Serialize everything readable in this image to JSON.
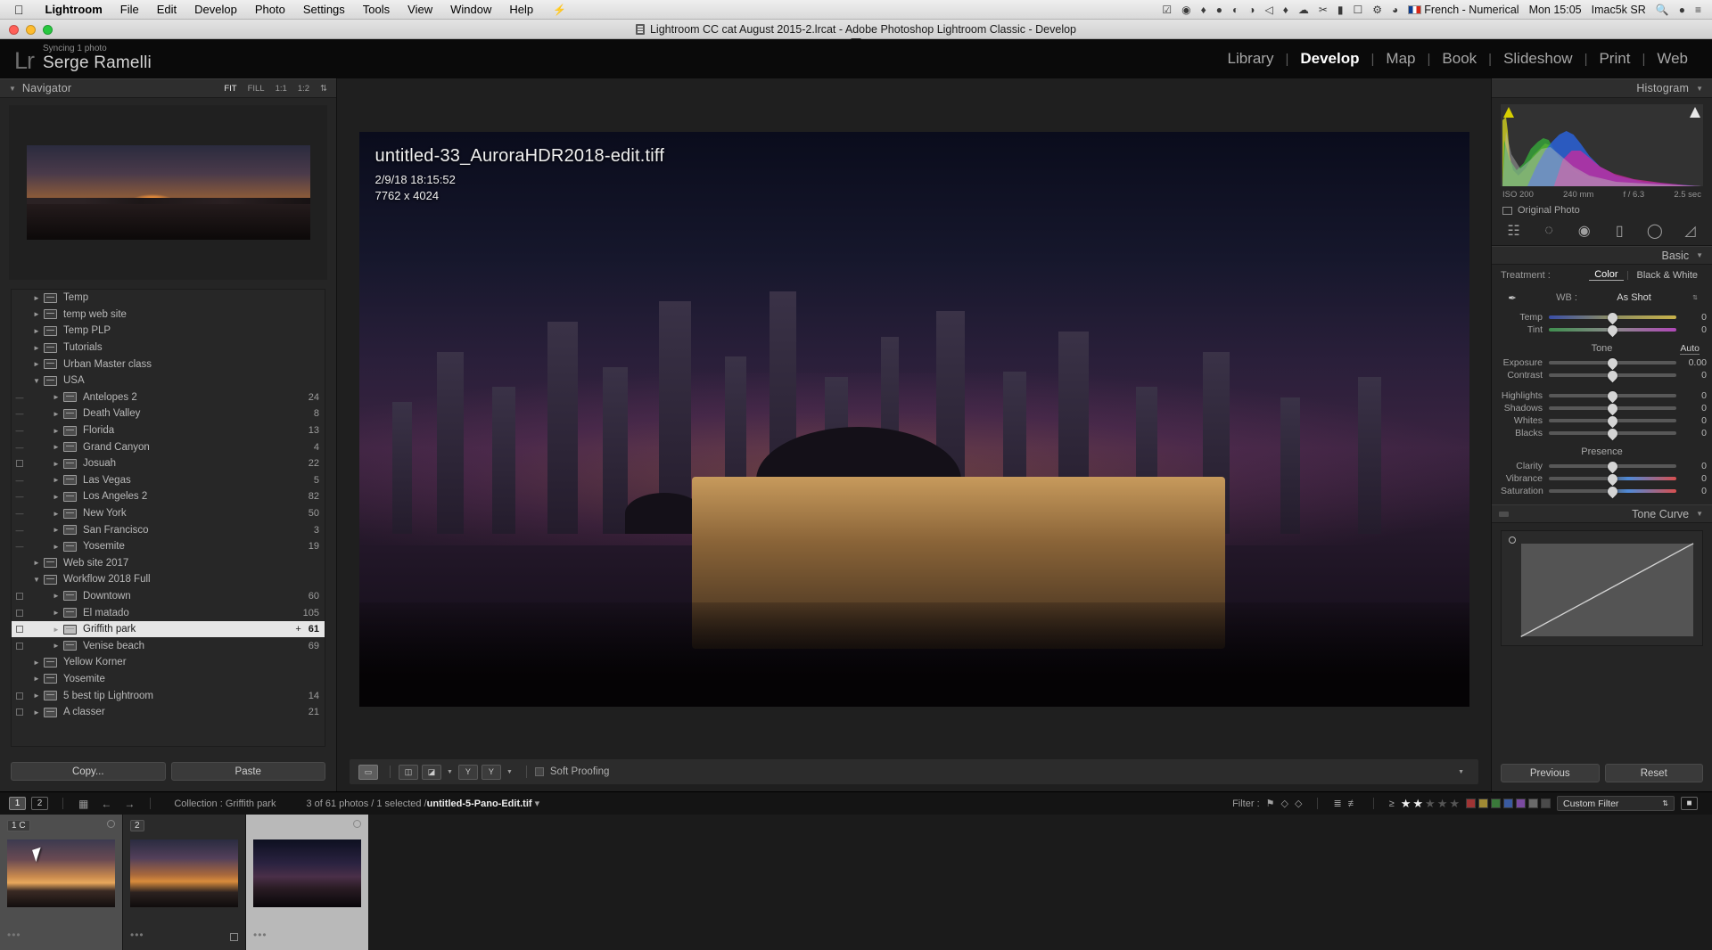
{
  "macbar": {
    "apple_icon": "apple-icon",
    "menus": [
      "Lightroom",
      "File",
      "Edit",
      "Develop",
      "Photo",
      "Settings",
      "Tools",
      "View",
      "Window",
      "Help"
    ],
    "status_icons": [
      "bolt-icon",
      "check-circle-icon",
      "screen-record-icon",
      "dropbox-icon",
      "camera-icon",
      "hazel-icon",
      "nvidia-icon",
      "evernote-icon",
      "flame-icon",
      "cloud-icon",
      "wrench-icon",
      "battery-icon",
      "airplay-icon",
      "vpn-icon",
      "wifi-icon"
    ],
    "language": "French - Numerical",
    "clock": "Mon 15:05",
    "user": "Imac5k SR",
    "search_icon": "search-icon",
    "siri_icon": "siri-icon",
    "controlcenter_icon": "control-center-icon"
  },
  "titlebar": {
    "doc_icon": "document-icon",
    "title": "Lightroom CC cat August 2015-2.lrcat - Adobe Photoshop Lightroom Classic - Develop"
  },
  "header": {
    "logo": "Lr",
    "sync_status": "Syncing 1 photo",
    "identity": "Serge Ramelli",
    "modules": [
      {
        "label": "Library",
        "active": false
      },
      {
        "label": "Develop",
        "active": true
      },
      {
        "label": "Map",
        "active": false
      },
      {
        "label": "Book",
        "active": false
      },
      {
        "label": "Slideshow",
        "active": false
      },
      {
        "label": "Print",
        "active": false
      },
      {
        "label": "Web",
        "active": false
      }
    ]
  },
  "navigator": {
    "title": "Navigator",
    "zoom_levels": [
      {
        "label": "FIT",
        "active": true
      },
      {
        "label": "FILL",
        "active": false
      },
      {
        "label": "1:1",
        "active": false
      },
      {
        "label": "1:2",
        "active": false
      }
    ],
    "chevron": "chevron-down-icon"
  },
  "folders": [
    {
      "name": "Temp",
      "count": "",
      "indent": 1,
      "expanded": false,
      "selected": false,
      "checkbox": false,
      "dash": false,
      "hollow": true
    },
    {
      "name": "temp  web site",
      "count": "",
      "indent": 1,
      "expanded": false,
      "selected": false,
      "checkbox": false,
      "dash": false,
      "hollow": true
    },
    {
      "name": "Temp PLP",
      "count": "",
      "indent": 1,
      "expanded": false,
      "selected": false,
      "checkbox": false,
      "dash": false,
      "hollow": true
    },
    {
      "name": "Tutorials",
      "count": "",
      "indent": 1,
      "expanded": false,
      "selected": false,
      "checkbox": false,
      "dash": false,
      "hollow": true
    },
    {
      "name": "Urban Master class",
      "count": "",
      "indent": 1,
      "expanded": false,
      "selected": false,
      "checkbox": false,
      "dash": false,
      "hollow": true
    },
    {
      "name": "USA",
      "count": "",
      "indent": 1,
      "expanded": true,
      "selected": false,
      "checkbox": false,
      "dash": false,
      "hollow": true
    },
    {
      "name": "Antelopes 2",
      "count": "24",
      "indent": 2,
      "expanded": false,
      "selected": false,
      "checkbox": false,
      "dash": true,
      "hollow": false
    },
    {
      "name": "Death Valley",
      "count": "8",
      "indent": 2,
      "expanded": false,
      "selected": false,
      "checkbox": false,
      "dash": true,
      "hollow": false
    },
    {
      "name": "Florida",
      "count": "13",
      "indent": 2,
      "expanded": false,
      "selected": false,
      "checkbox": false,
      "dash": true,
      "hollow": false
    },
    {
      "name": "Grand Canyon",
      "count": "4",
      "indent": 2,
      "expanded": false,
      "selected": false,
      "checkbox": false,
      "dash": true,
      "hollow": false
    },
    {
      "name": "Josuah",
      "count": "22",
      "indent": 2,
      "expanded": false,
      "selected": false,
      "checkbox": true,
      "dash": false,
      "hollow": false
    },
    {
      "name": "Las Vegas",
      "count": "5",
      "indent": 2,
      "expanded": false,
      "selected": false,
      "checkbox": false,
      "dash": true,
      "hollow": false
    },
    {
      "name": "Los Angeles 2",
      "count": "82",
      "indent": 2,
      "expanded": false,
      "selected": false,
      "checkbox": false,
      "dash": true,
      "hollow": false
    },
    {
      "name": "New York",
      "count": "50",
      "indent": 2,
      "expanded": false,
      "selected": false,
      "checkbox": false,
      "dash": true,
      "hollow": false
    },
    {
      "name": "San Francisco",
      "count": "3",
      "indent": 2,
      "expanded": false,
      "selected": false,
      "checkbox": false,
      "dash": true,
      "hollow": false
    },
    {
      "name": "Yosemite",
      "count": "19",
      "indent": 2,
      "expanded": false,
      "selected": false,
      "checkbox": false,
      "dash": true,
      "hollow": false
    },
    {
      "name": "Web site 2017",
      "count": "",
      "indent": 1,
      "expanded": false,
      "selected": false,
      "checkbox": false,
      "dash": false,
      "hollow": true
    },
    {
      "name": "Workflow 2018 Full",
      "count": "",
      "indent": 1,
      "expanded": true,
      "selected": false,
      "checkbox": false,
      "dash": false,
      "hollow": true
    },
    {
      "name": "Downtown",
      "count": "60",
      "indent": 2,
      "expanded": false,
      "selected": false,
      "checkbox": true,
      "dash": false,
      "hollow": false
    },
    {
      "name": "El matado",
      "count": "105",
      "indent": 2,
      "expanded": false,
      "selected": false,
      "checkbox": true,
      "dash": false,
      "hollow": false
    },
    {
      "name": "Griffith park",
      "count": "61",
      "indent": 2,
      "expanded": false,
      "selected": true,
      "checkbox": true,
      "dash": false,
      "hollow": false,
      "plus": "+"
    },
    {
      "name": "Venise beach",
      "count": "69",
      "indent": 2,
      "expanded": false,
      "selected": false,
      "checkbox": true,
      "dash": false,
      "hollow": false
    },
    {
      "name": "Yellow Korner",
      "count": "",
      "indent": 1,
      "expanded": false,
      "selected": false,
      "checkbox": false,
      "dash": false,
      "hollow": true
    },
    {
      "name": "Yosemite",
      "count": "",
      "indent": 1,
      "expanded": false,
      "selected": false,
      "checkbox": false,
      "dash": false,
      "hollow": true
    },
    {
      "name": "5 best tip Lightroom",
      "count": "14",
      "indent": 1,
      "expanded": false,
      "selected": false,
      "checkbox": true,
      "dash": false,
      "hollow": false
    },
    {
      "name": "A classer",
      "count": "21",
      "indent": 1,
      "expanded": false,
      "selected": false,
      "checkbox": true,
      "dash": false,
      "hollow": false
    }
  ],
  "left_buttons": {
    "copy": "Copy...",
    "paste": "Paste"
  },
  "photo_info": {
    "filename": "untitled-33_AuroraHDR2018-edit.tiff",
    "datetime": "2/9/18 18:15:52",
    "dimensions": "7762 x 4024"
  },
  "center_toolbar": {
    "loupe_icon": "loupe-view-icon",
    "compare_icon": "before-after-compare-icon",
    "reference_icon": "reference-view-icon",
    "soft_proofing_label": "Soft Proofing",
    "dropdown_icon": "chevron-down-icon",
    "more_icon": "chevron-down-icon"
  },
  "histogram": {
    "title": "Histogram",
    "chevron": "chevron-down-icon",
    "shadow_clip_icon": "shadow-clipping-icon",
    "highlight_clip_icon": "highlight-clipping-icon",
    "iso": "ISO 200",
    "focal": "240 mm",
    "aperture": "f / 6.3",
    "shutter": "2.5 sec",
    "original_photo": "Original Photo"
  },
  "tool_strip": [
    "crop-icon",
    "spot-removal-icon",
    "red-eye-icon",
    "graduated-filter-icon",
    "radial-filter-icon",
    "adjustment-brush-icon"
  ],
  "basic": {
    "title": "Basic",
    "chevron": "chevron-down-icon",
    "treatment_label": "Treatment :",
    "treatment_color": "Color",
    "treatment_bw": "Black & White",
    "eyedropper_icon": "white-balance-eyedropper-icon",
    "wb_label": "WB :",
    "wb_value": "As Shot",
    "wb_chevron": "chevron-down-icon",
    "sliders_wb": [
      {
        "label": "Temp",
        "value": "0",
        "pos": 50
      },
      {
        "label": "Tint",
        "value": "0",
        "pos": 50
      }
    ],
    "tone_title": "Tone",
    "auto_label": "Auto",
    "sliders_tone": [
      {
        "label": "Exposure",
        "value": "0.00",
        "pos": 50
      },
      {
        "label": "Contrast",
        "value": "0",
        "pos": 50
      }
    ],
    "sliders_tone2": [
      {
        "label": "Highlights",
        "value": "0",
        "pos": 50
      },
      {
        "label": "Shadows",
        "value": "0",
        "pos": 50
      },
      {
        "label": "Whites",
        "value": "0",
        "pos": 50
      },
      {
        "label": "Blacks",
        "value": "0",
        "pos": 50
      }
    ],
    "presence_title": "Presence",
    "sliders_presence": [
      {
        "label": "Clarity",
        "value": "0",
        "pos": 50
      },
      {
        "label": "Vibrance",
        "value": "0",
        "pos": 50
      },
      {
        "label": "Saturation",
        "value": "0",
        "pos": 50
      }
    ]
  },
  "tone_curve": {
    "title": "Tone Curve",
    "chevron": "chevron-down-icon"
  },
  "right_buttons": {
    "previous": "Previous",
    "reset": "Reset"
  },
  "filmstrip_bar": {
    "screen1": "1",
    "screen2": "2",
    "grid_icon": "grid-view-icon",
    "back_icon": "back-arrow-icon",
    "forward_icon": "forward-arrow-icon",
    "source": "Collection : Griffith park",
    "status_prefix": "3 of 61 photos / 1 selected /",
    "status_file": "untitled-5-Pano-Edit.tif",
    "status_chevron": "chevron-down-icon",
    "filter_label": "Filter :",
    "flag_icons": [
      "flag-picked-icon",
      "flag-unflagged-icon",
      "flag-rejected-icon"
    ],
    "sort_icons": [
      "sort-ascending-icon",
      "sort-descending-icon"
    ],
    "rating_operator": "≥",
    "stars": [
      true,
      true,
      false,
      false,
      false
    ],
    "color_labels": [
      "#a03434",
      "#a08a34",
      "#3a7a3a",
      "#3a5aa0",
      "#7a4aa0",
      "#6a6a6a",
      "#4a4a4a"
    ],
    "custom_filter": "Custom Filter",
    "custom_filter_chevron": "chevron-down-icon",
    "lock_icon": "filter-lock-icon"
  },
  "thumbnails": [
    {
      "badge": "1 C",
      "selected": true,
      "dots": "•••",
      "circle": true,
      "square": false
    },
    {
      "badge": "2",
      "selected": false,
      "dots": "•••",
      "circle": false,
      "square": true
    },
    {
      "badge": "",
      "selected": false,
      "light": true,
      "dots": "•••",
      "circle": true,
      "square": false
    }
  ]
}
